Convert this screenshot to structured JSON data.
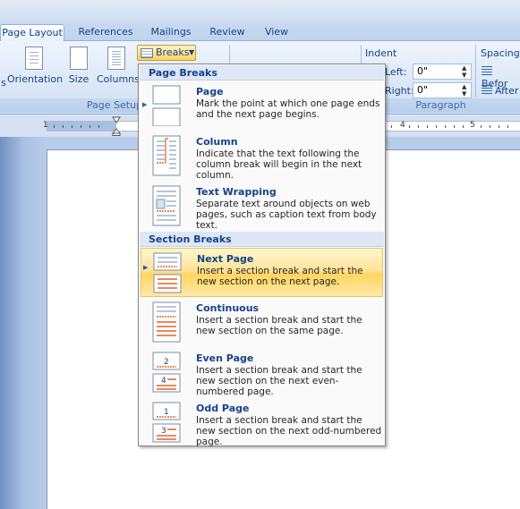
{
  "tabs": [
    {
      "label": "Page Layout",
      "active": true
    },
    {
      "label": "References",
      "active": false
    },
    {
      "label": "Mailings",
      "active": false
    },
    {
      "label": "Review",
      "active": false
    },
    {
      "label": "View",
      "active": false
    }
  ],
  "ribbon": {
    "page_setup": {
      "partial_label": "s",
      "orientation": "Orientation",
      "size": "Size",
      "columns": "Columns",
      "breaks": "Breaks",
      "group_label": "Page Setup"
    },
    "paragraph": {
      "indent_header": "Indent",
      "left_label": "Left:",
      "left_value": "0\"",
      "right_label": "Right:",
      "right_value": "0\"",
      "spacing_header": "Spacing",
      "before_label": "Befor",
      "after_label": "After",
      "group_label": "Paragraph"
    }
  },
  "ruler": {
    "numbers": [
      "1",
      "4",
      "5"
    ]
  },
  "breaks_menu": {
    "page_breaks_header": "Page Breaks",
    "section_breaks_header": "Section Breaks",
    "items": [
      {
        "title": "Page",
        "description": "Mark the point at which one page ends and the next page begins.",
        "icon": "page-break-icon"
      },
      {
        "title": "Column",
        "description": "Indicate that the text following the column break will begin in the next column.",
        "icon": "column-break-icon"
      },
      {
        "title": "Text Wrapping",
        "description": "Separate text around objects on web pages, such as caption text from body text.",
        "icon": "text-wrapping-icon"
      },
      {
        "title": "Next Page",
        "description": "Insert a section break and start the new section on the next page.",
        "icon": "next-page-icon",
        "highlighted": true
      },
      {
        "title": "Continuous",
        "description": "Insert a section break and start the new section on the same page.",
        "icon": "continuous-icon"
      },
      {
        "title": "Even Page",
        "description": "Insert a section break and start the new section on the next even-numbered page.",
        "icon": "even-page-icon",
        "page_numbers": [
          "2",
          "4"
        ]
      },
      {
        "title": "Odd Page",
        "description": "Insert a section break and start the new section on the next odd-numbered page.",
        "icon": "odd-page-icon",
        "page_numbers": [
          "1",
          "3"
        ]
      }
    ]
  },
  "colors": {
    "accent": "#15428b",
    "highlight": "#ffd561",
    "section_break_orange": "#e0622a"
  }
}
